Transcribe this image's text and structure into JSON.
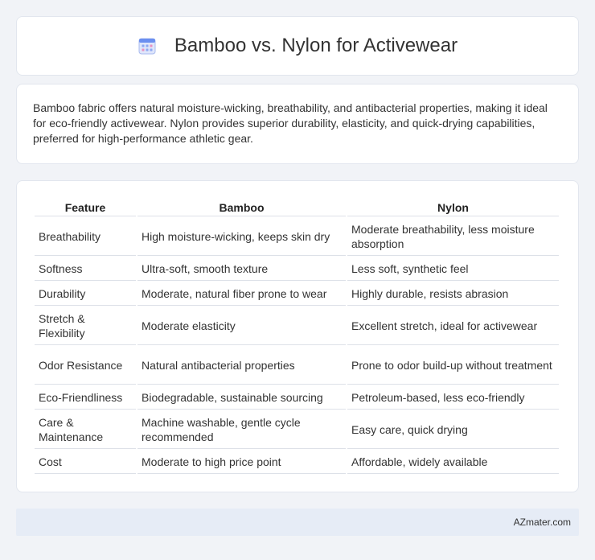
{
  "header": {
    "title": "Bamboo vs. Nylon for Activewear",
    "icon": "calendar-icon"
  },
  "intro": {
    "text": "Bamboo fabric offers natural moisture-wicking, breathability, and antibacterial properties, making it ideal for eco-friendly activewear. Nylon provides superior durability, elasticity, and quick-drying capabilities, preferred for high-performance athletic gear."
  },
  "table": {
    "headers": [
      "Feature",
      "Bamboo",
      "Nylon"
    ],
    "rows": [
      [
        "Breathability",
        "High moisture-wicking, keeps skin dry",
        "Moderate breathability, less moisture absorption"
      ],
      [
        "Softness",
        "Ultra-soft, smooth texture",
        "Less soft, synthetic feel"
      ],
      [
        "Durability",
        "Moderate, natural fiber prone to wear",
        "Highly durable, resists abrasion"
      ],
      [
        "Stretch & Flexibility",
        "Moderate elasticity",
        "Excellent stretch, ideal for activewear"
      ],
      [
        "Odor Resistance",
        "Natural antibacterial properties",
        "Prone to odor build-up without treatment"
      ],
      [
        "Eco-Friendliness",
        "Biodegradable, sustainable sourcing",
        "Petroleum-based, less eco-friendly"
      ],
      [
        "Care & Maintenance",
        "Machine washable, gentle cycle recommended",
        "Easy care, quick drying"
      ],
      [
        "Cost",
        "Moderate to high price point",
        "Affordable, widely available"
      ]
    ]
  },
  "footer": {
    "text": "AZmater.com"
  },
  "colors": {
    "background": "#f1f3f7",
    "card": "#ffffff",
    "footer": "#e6ecf6",
    "icon_blue": "#6b8ff0",
    "icon_pink": "#e891c0"
  }
}
